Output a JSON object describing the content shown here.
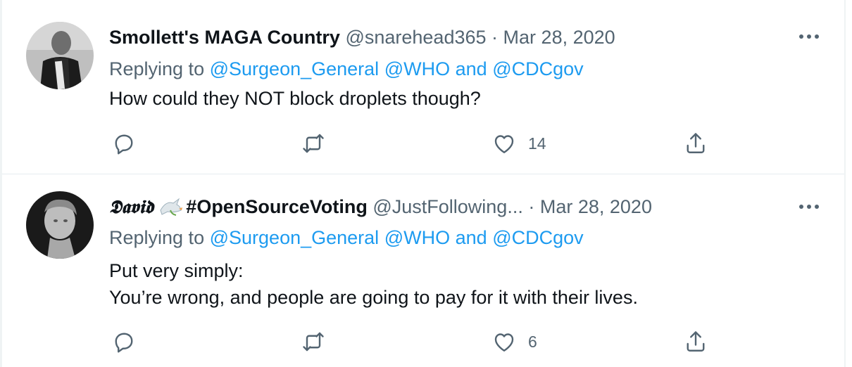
{
  "tweets": [
    {
      "display_name": "Smollett's MAGA Country",
      "handle": "@snarehead365",
      "separator": "·",
      "date": "Mar 28, 2020",
      "replying_prefix": "Replying to",
      "replying_to_1": "@Surgeon_General",
      "replying_to_2": "@WHO",
      "replying_and": "and",
      "replying_to_3": "@CDCgov",
      "text_lines": [
        "How could they NOT block droplets though?"
      ],
      "likes": "14"
    },
    {
      "display_name_fancy": "𝕯𝖆𝖛𝖎𝖉",
      "display_name_rest": "#OpenSourceVoting",
      "handle": "@JustFollowing...",
      "separator": "·",
      "date": "Mar 28, 2020",
      "replying_prefix": "Replying to",
      "replying_to_1": "@Surgeon_General",
      "replying_to_2": "@WHO",
      "replying_and": "and",
      "replying_to_3": "@CDCgov",
      "text_lines": [
        "Put very simply:",
        "You’re wrong, and people are going to pay for it with their lives."
      ],
      "likes": "6"
    }
  ],
  "icons": {
    "reply": "reply-icon",
    "retweet": "retweet-icon",
    "like": "heart-icon",
    "share": "share-icon",
    "more": "more-icon",
    "emoji": "dove-icon"
  },
  "colors": {
    "link": "#1d9bf0",
    "muted": "#536471",
    "text": "#0f1419",
    "divider": "#e6ecf0"
  }
}
